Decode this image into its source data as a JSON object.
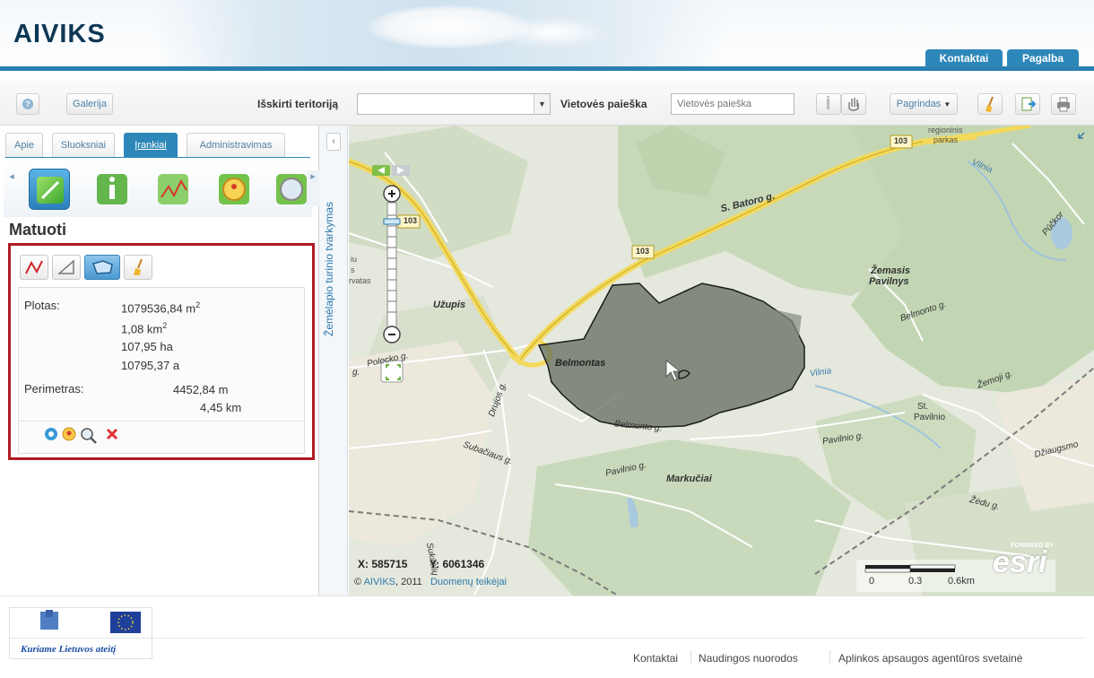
{
  "app": {
    "logo": "AIVIKS"
  },
  "header_nav": {
    "kontaktai": "Kontaktai",
    "pagalba": "Pagalba"
  },
  "toolbar": {
    "galerija": "Galerija",
    "territory_label": "Išskirti teritoriją",
    "territory_value": "",
    "search_label": "Vietovės paieška",
    "search_placeholder": "Vietovės paieška",
    "basemap": "Pagrindas"
  },
  "tabs": [
    {
      "label": "Apie"
    },
    {
      "label": "Sluoksniai"
    },
    {
      "label": "Įrankiai"
    },
    {
      "label": "Administravimas"
    }
  ],
  "tools": {
    "title": "Matuoti"
  },
  "results": {
    "area_label": "Plotas:",
    "area_m2": "1079536,84 m",
    "area_km2": "1,08 km",
    "area_ha": "107,95 ha",
    "area_a": "10795,37 a",
    "perimeter_label": "Perimetras:",
    "perimeter_m": "4452,84 m",
    "perimeter_km": "4,45 km",
    "sup2": "2"
  },
  "side_label": "Žemėlapio turinio tvarkymas",
  "map": {
    "x_label": "X:",
    "x_value": "585715",
    "y_label": "Y:",
    "y_value": "6061346",
    "copyright": "© ",
    "copyright_link": "AIVIKS",
    "copyright_year": ", 2011",
    "providers": "Duomenų teikėjai",
    "scale": [
      "0",
      "0.3",
      "0.6km"
    ],
    "esri": "esri",
    "powered": "POWERED BY",
    "labels": {
      "batoro": "S. Batoro g.",
      "uzupis": "Užupis",
      "polocko": "Polocko g.",
      "belmontas": "Belmontas",
      "drujos": "Drujos g.",
      "subaciaus": "Subačiaus g.",
      "pavilnio": "Pavilnio g.",
      "markuciai": "Markučiai",
      "belmonto": "Belmonto g.",
      "belmonto2": "Belmonto g.",
      "vilnia": "Vilnia",
      "vilnia2": "Vilnia",
      "zemasis": "Žemasis",
      "pavilnys": "Pavilnys",
      "pavilnio2": "Pavilnio g.",
      "zemoji": "Žemoji g.",
      "st": "St.",
      "stpav": "Pavilnio",
      "regioninis": "regioninis",
      "parkas": "parkas",
      "dziaugsmo": "Džiaugsmo",
      "zedu": "Žėdu g.",
      "pucko": "Pūčkor",
      "g": "g.",
      "sukieliu": "Sukilėlių",
      "r103a": "103",
      "r103b": "103",
      "r103c": "103",
      "sluoksnis": "rvatas",
      "iu": "iu",
      "s": "s"
    }
  },
  "footer": {
    "eu_text": "Kuriame Lietuvos ateitį",
    "links": [
      "Kontaktai",
      "Naudingos nuorodos",
      "Aplinkos apsaugos agentūros svetainė"
    ]
  },
  "colors": {
    "accent": "#2d87b9",
    "highlight_box": "#b21c25",
    "polygon": "#5c665a"
  }
}
